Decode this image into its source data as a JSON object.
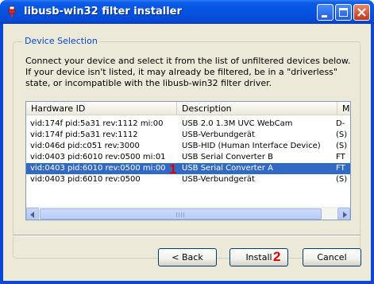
{
  "window": {
    "title": "libusb-win32 filter installer"
  },
  "group": {
    "caption": "Device Selection"
  },
  "intro": "Connect your device and select it from the list of unfiltered devices below. If your device isn't listed, it may already be filtered, be in a \"driverless\" state, or incompatible with the libusb-win32 filter driver.",
  "list": {
    "columns": [
      "Hardware ID",
      "Description",
      "M"
    ],
    "rows": [
      {
        "hardware_id": "vid:174f pid:5a31 rev:1112 mi:00",
        "description": "USB 2.0 1.3M UVC WebCam",
        "m": "D-"
      },
      {
        "hardware_id": "vid:174f pid:5a31 rev:1112",
        "description": "USB-Verbundgerät",
        "m": "(S)"
      },
      {
        "hardware_id": "vid:046d pid:c051 rev:3000",
        "description": "USB-HID (Human Interface Device)",
        "m": "(S)"
      },
      {
        "hardware_id": "vid:0403 pid:6010 rev:0500 mi:01",
        "description": "USB Serial Converter B",
        "m": "FT"
      },
      {
        "hardware_id": "vid:0403 pid:6010 rev:0500 mi:00",
        "description": "USB Serial Converter A",
        "m": "FT"
      },
      {
        "hardware_id": "vid:0403 pid:6010 rev:0500",
        "description": "USB-Verbundgerät",
        "m": "(S)"
      }
    ],
    "selected_index": 4
  },
  "markers": {
    "first": "1",
    "second": "2"
  },
  "buttons": {
    "back": "< Back",
    "install": "Install",
    "cancel": "Cancel"
  },
  "colors": {
    "titlebar": "#0553e1",
    "selection": "#316ac5",
    "group_caption": "#0046d5",
    "marker": "#e00000"
  }
}
